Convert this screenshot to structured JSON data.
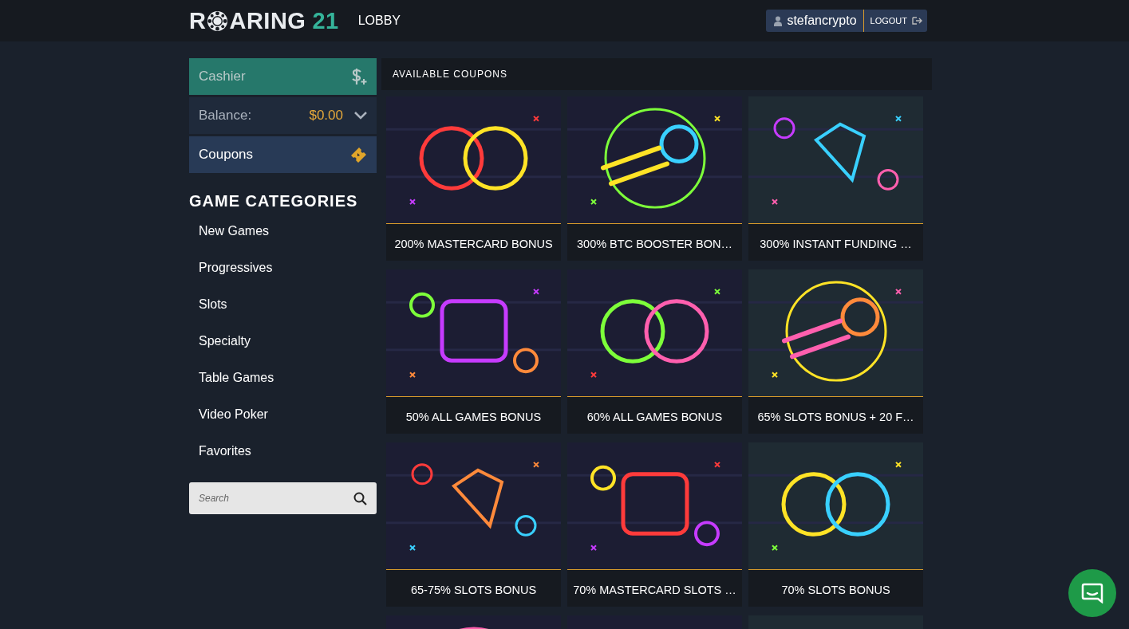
{
  "header": {
    "logo": {
      "before": "R",
      "after": "ARING",
      "number": "21"
    },
    "nav": "LOBBY",
    "user": "stefancrypto",
    "logout": "LOGOUT"
  },
  "sidebar": {
    "cashier": "Cashier",
    "balance_label": "Balance:",
    "balance": "$0.00",
    "coupons": "Coupons",
    "categories_title": "GAME CATEGORIES",
    "categories": [
      "New Games",
      "Progressives",
      "Slots",
      "Specialty",
      "Table Games",
      "Video Poker",
      "Favorites"
    ],
    "search": {
      "placeholder": "Search"
    }
  },
  "coupons_title": "AVAILABLE COUPONS",
  "coupons": [
    {
      "title": "200% MASTERCARD BONUS"
    },
    {
      "title": "300% BTC BOOSTER BON…"
    },
    {
      "title": "300% INSTANT FUNDING …"
    },
    {
      "title": "50% ALL GAMES BONUS"
    },
    {
      "title": "60% ALL GAMES BONUS"
    },
    {
      "title": "65% SLOTS BONUS + 20 F…"
    },
    {
      "title": "65-75% SLOTS BONUS"
    },
    {
      "title": "70% MASTERCARD SLOTS …"
    },
    {
      "title": "70% SLOTS BONUS"
    },
    {
      "kind": "picture"
    },
    {
      "kind": "picture"
    },
    {
      "kind": "picture"
    }
  ]
}
